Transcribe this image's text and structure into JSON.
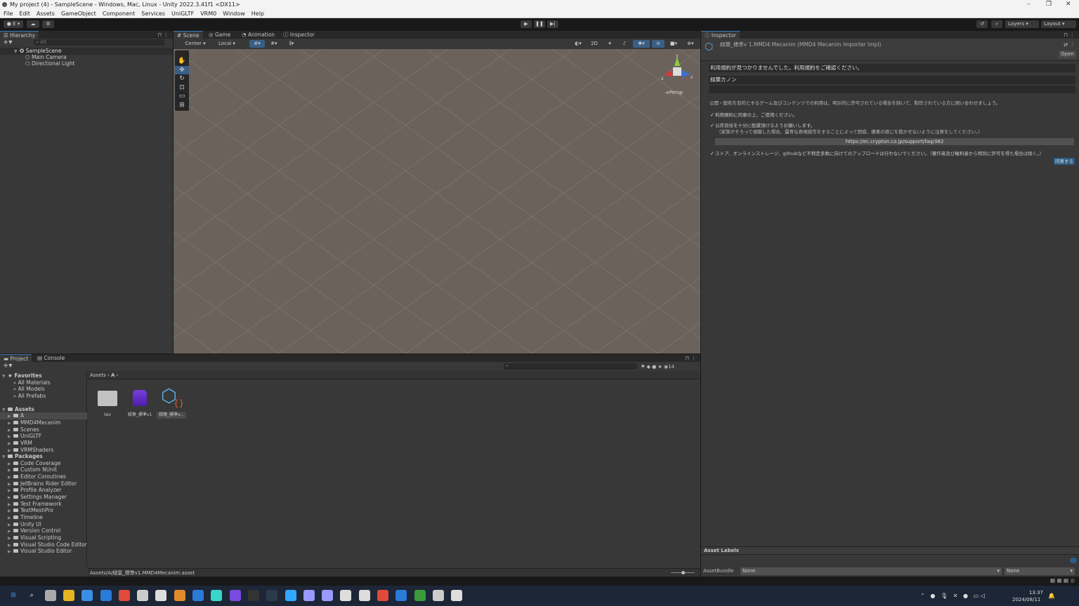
{
  "window": {
    "title": "My project (4) - SampleScene - Windows, Mac, Linux - Unity 2022.3.41f1 <DX11>"
  },
  "menu": [
    "File",
    "Edit",
    "Assets",
    "GameObject",
    "Component",
    "Services",
    "UniGLTF",
    "VRM0",
    "Window",
    "Help"
  ],
  "toolbar": {
    "account": "E",
    "layers": "Layers",
    "layout": "Layout"
  },
  "hierarchy": {
    "tab": "Hierarchy",
    "search_placeholder": "All",
    "scene": "SampleScene",
    "items": [
      "Main Camera",
      "Directional Light"
    ]
  },
  "scene_tabs": [
    "Scene",
    "Game",
    "Animation",
    "Inspector"
  ],
  "scene_toolbar": {
    "pivot": "Center",
    "space": "Local",
    "mode_2d": "2D",
    "persp": "Persp"
  },
  "inspector": {
    "tab": "Inspector",
    "title": "緑葉_標準v 1.MMD4 Mecanim (MMD4 Mecanim Importer Impl)",
    "open": "Open",
    "notice": "利用規約が見つかりませんでした。利用規約をご確認ください。",
    "name_field": "緑葉カノン",
    "info": "公開・配布を目的とするゲーム及びコンテンツでの利用は、明示的に許可されている場合を除いて、制作されている方に問い合わせましょう。",
    "checks": [
      {
        "label": "利用規約に同意の上、ご使用ください。",
        "checked": true
      },
      {
        "label": "公序良俗を十分に配慮頂けるようお願いします。",
        "sub": "（家族がそろって視聴した場合、露骨な表現描写をすることによって困惑、嫌悪の感じを抱かせないように注意をしてください。）",
        "checked": true
      },
      {
        "label": "ストア、オンラインストレージ、githubなど不特定多数に向けてのアップロードは行わないでください。（著作者及び権利者から特別に許可を得た場合は除く。）",
        "checked": true
      }
    ],
    "url": "https://ec.crypton.co.jp/support/faq/362",
    "agree": "同意する",
    "asset_labels": "Asset Labels",
    "asset_bundle": "AssetBundle",
    "bundle_value": "None",
    "variant_value": "None"
  },
  "project": {
    "tabs": [
      "Project",
      "Console"
    ],
    "favorites_label": "Favorites",
    "favorites": [
      "All Materials",
      "All Models",
      "All Prefabs"
    ],
    "assets_label": "Assets",
    "assets": [
      "A",
      "MMD4Mecanim",
      "Scenes",
      "UniGLTF",
      "VRM",
      "VRMShaders"
    ],
    "packages_label": "Packages",
    "packages": [
      "Code Coverage",
      "Custom NUnit",
      "Editor Coroutines",
      "JetBrains Rider Editor",
      "Profile Analyzer",
      "Settings Manager",
      "Test Framework",
      "TextMeshPro",
      "Timeline",
      "Unity UI",
      "Version Control",
      "Visual Scripting",
      "Visual Studio Code Editor",
      "Visual Studio Editor"
    ],
    "breadcrumb": [
      "Assets",
      "A"
    ],
    "files": [
      {
        "name": "tex",
        "icon": "folder-icon"
      },
      {
        "name": "緑葉_標準v1",
        "icon": "model-icon"
      },
      {
        "name": "緑葉_標準v...",
        "icon": "mmd4-asset-icon"
      }
    ],
    "hidden_count": "14",
    "path": "Assets/A/緑葉_標準v1.MMD4Mecanim.asset"
  },
  "taskbar": {
    "time": "13:37",
    "date": "2024/08/11"
  },
  "colors": {
    "accent": "#3a79bb",
    "scene_bg": "#6a625b",
    "selection": "#2c5d87"
  }
}
